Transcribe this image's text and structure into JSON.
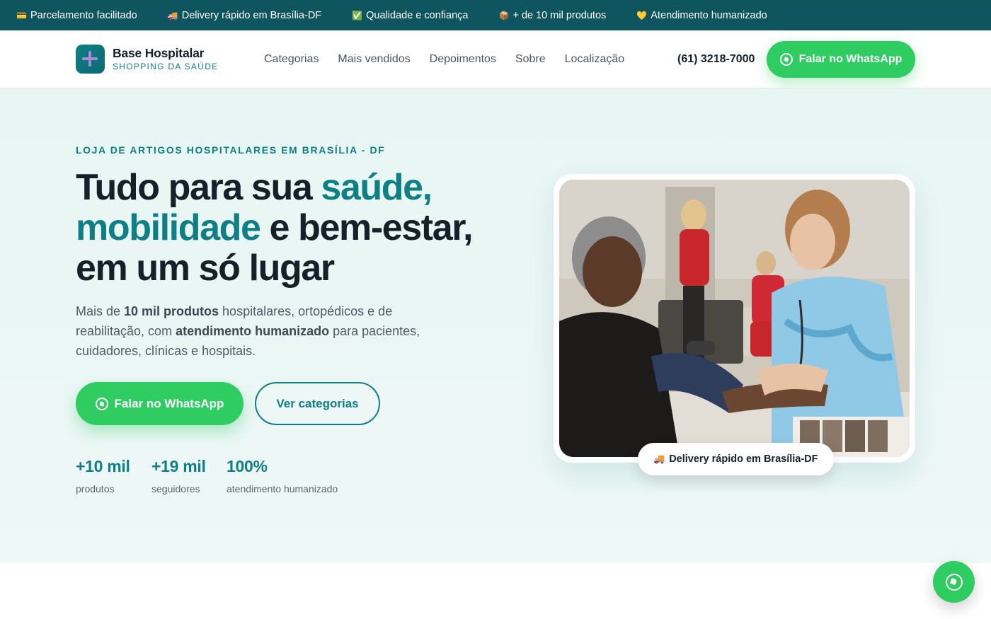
{
  "topbar": {
    "items": [
      {
        "icon": "credit-card-icon",
        "glyph": "💳",
        "label": "Parcelamento facilitado"
      },
      {
        "icon": "truck-icon",
        "glyph": "🚚",
        "label": "Delivery rápido em Brasília-DF"
      },
      {
        "icon": "check-icon",
        "glyph": "✅",
        "label": "Qualidade e confiança"
      },
      {
        "icon": "package-icon",
        "glyph": "📦",
        "label": "+ de 10 mil produtos"
      },
      {
        "icon": "heart-icon",
        "glyph": "💛",
        "label": "Atendimento humanizado"
      }
    ]
  },
  "header": {
    "logo_name": "Base Hospitalar",
    "logo_sub": "SHOPPING DA SAÚDE",
    "nav": [
      "Categorias",
      "Mais vendidos",
      "Depoimentos",
      "Sobre",
      "Localização"
    ],
    "phone": "(61) 3218-7000",
    "whatsapp_label": "Falar no WhatsApp"
  },
  "hero": {
    "eyebrow": "LOJA DE ARTIGOS HOSPITALARES EM BRASÍLIA - DF",
    "headline": {
      "part1": "Tudo para sua ",
      "accent1": "saúde,",
      "accent2": "mobilidade",
      "part2": " e bem-estar,",
      "part3": "em um só lugar"
    },
    "lead": {
      "t1": "Mais de ",
      "b1": "10 mil produtos",
      "t2": " hospitalares, ortopédicos e de reabilitação, com ",
      "b2": "atendimento humanizado",
      "t3": " para pacientes, cuidadores, clínicas e hospitais."
    },
    "cta_whatsapp": "Falar no WhatsApp",
    "cta_categories": "Ver categorias",
    "stats": [
      {
        "value": "+10 mil",
        "label": "produtos"
      },
      {
        "value": "+19 mil",
        "label": "seguidores"
      },
      {
        "value": "100%",
        "label": "atendimento humanizado"
      }
    ],
    "badge": {
      "glyph": "🚚",
      "label": "Delivery rápido em Brasília-DF"
    }
  },
  "colors": {
    "brand": "#0f7f86",
    "topbar_bg": "#0e5560",
    "whatsapp": "#2ecc61",
    "hero_bg": "#e7f5f3",
    "text_dark": "#16202a"
  }
}
